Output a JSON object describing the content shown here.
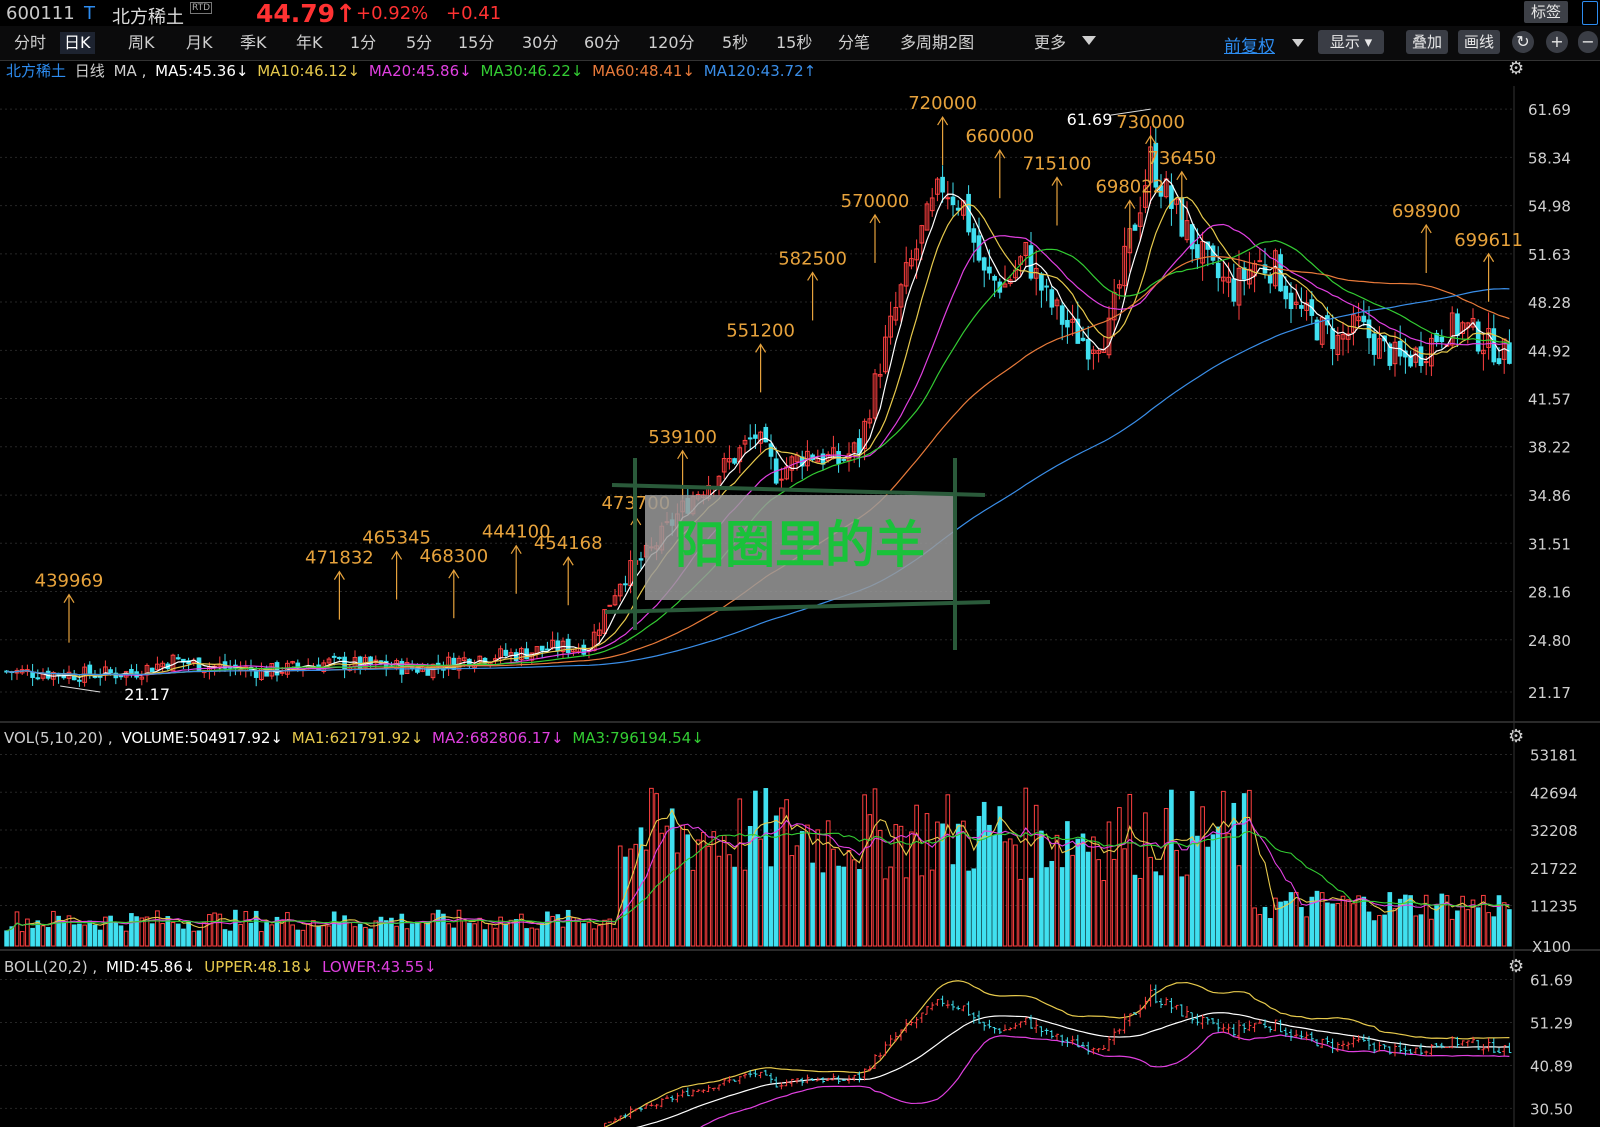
{
  "header": {
    "code": "600111",
    "flag": "T",
    "name": "北方稀土",
    "rtd": "RTD",
    "price": "44.79↑",
    "pct": "+0.92%",
    "change": "+0.41",
    "tag_button": "标签"
  },
  "periods": [
    "分时",
    "日K",
    "周K",
    "月K",
    "季K",
    "年K",
    "1分",
    "5分",
    "15分",
    "30分",
    "60分",
    "120分",
    "5秒",
    "15秒",
    "分笔",
    "多周期2图",
    "更多"
  ],
  "selected_period": "日K",
  "toolbar": {
    "adjust": "前复权",
    "display": "显示",
    "overlay": "叠加",
    "draw": "画线",
    "refresh_icon": "↻",
    "zoom_in": "+",
    "zoom_out": "−"
  },
  "main_legend": {
    "name": "北方稀土",
    "period": "日线",
    "ma": "MA ,",
    "ma5": "MA5:45.36↓",
    "ma10": "MA10:46.12↓",
    "ma20": "MA20:45.86↓",
    "ma30": "MA30:46.22↓",
    "ma60": "MA60:48.41↓",
    "ma120": "MA120:43.72↑"
  },
  "vol_legend": {
    "name": "VOL(5,10,20) ,",
    "volume": "VOLUME:504917.92↓",
    "ma1": "MA1:621791.92↓",
    "ma2": "MA2:682806.17↓",
    "ma3": "MA3:796194.54↓"
  },
  "boll_legend": {
    "name": "BOLL(20,2) ,",
    "mid": "MID:45.86↓",
    "upper": "UPPER:48.18↓",
    "lower": "LOWER:43.55↓"
  },
  "watermark": "阳圈里的羊",
  "colors": {
    "up": "#ff4040",
    "down": "#40e0f0",
    "ma5": "#ffffff",
    "ma10": "#e6c94c",
    "ma20": "#e040e0",
    "ma30": "#33cc33",
    "ma60": "#e87a3a",
    "ma120": "#3a8ee8"
  },
  "chart_data": [
    {
      "type": "candlestick",
      "panel": "price",
      "y_ticks": [
        "61.69",
        "58.34",
        "54.98",
        "51.63",
        "48.28",
        "44.92",
        "41.57",
        "38.22",
        "34.86",
        "31.51",
        "28.16",
        "24.80",
        "21.17"
      ],
      "ylim": [
        19.5,
        63.3
      ],
      "high": 61.69,
      "low": 21.17,
      "trend": [
        [
          0,
          22.6
        ],
        [
          14,
          22.4
        ],
        [
          24,
          22.5
        ],
        [
          32,
          23.4
        ],
        [
          38,
          23.0
        ],
        [
          50,
          22.6
        ],
        [
          62,
          23.2
        ],
        [
          72,
          23.0
        ],
        [
          80,
          22.8
        ],
        [
          90,
          23.6
        ],
        [
          98,
          23.8
        ],
        [
          104,
          24.2
        ],
        [
          112,
          24.4
        ],
        [
          118,
          29.0
        ],
        [
          124,
          31.0
        ],
        [
          128,
          33.0
        ],
        [
          132,
          34.8
        ],
        [
          138,
          36.8
        ],
        [
          144,
          39.0
        ],
        [
          148,
          36.4
        ],
        [
          154,
          37.8
        ],
        [
          160,
          37.2
        ],
        [
          164,
          38.2
        ],
        [
          168,
          44.0
        ],
        [
          172,
          49.0
        ],
        [
          176,
          53.0
        ],
        [
          180,
          56.5
        ],
        [
          184,
          55.0
        ],
        [
          188,
          50.0
        ],
        [
          192,
          49.5
        ],
        [
          196,
          51.6
        ],
        [
          200,
          48.5
        ],
        [
          204,
          46.6
        ],
        [
          208,
          45.4
        ],
        [
          212,
          46.3
        ],
        [
          216,
          52.5
        ],
        [
          220,
          58.2
        ],
        [
          224,
          55.0
        ],
        [
          228,
          52.5
        ],
        [
          232,
          50.2
        ],
        [
          236,
          49.2
        ],
        [
          240,
          51.0
        ],
        [
          244,
          50.7
        ],
        [
          248,
          47.8
        ],
        [
          252,
          46.6
        ],
        [
          256,
          45.6
        ],
        [
          260,
          46.6
        ],
        [
          264,
          45.2
        ],
        [
          268,
          44.2
        ],
        [
          272,
          44.8
        ],
        [
          276,
          46.3
        ],
        [
          280,
          46.6
        ],
        [
          284,
          45.6
        ],
        [
          288,
          44.7
        ]
      ],
      "vol_annotations": [
        {
          "label": "439969",
          "bar": 12,
          "price": 24.6
        },
        {
          "label": "471832",
          "bar": 64,
          "price": 26.2
        },
        {
          "label": "465345",
          "bar": 75,
          "price": 27.6
        },
        {
          "label": "468300",
          "bar": 86,
          "price": 26.3
        },
        {
          "label": "444100",
          "bar": 98,
          "price": 28.0
        },
        {
          "label": "454168",
          "bar": 108,
          "price": 27.2
        },
        {
          "label": "473700",
          "bar": 121,
          "price": 30.0
        },
        {
          "label": "539100",
          "bar": 130,
          "price": 34.6
        },
        {
          "label": "551200",
          "bar": 145,
          "price": 42.0
        },
        {
          "label": "582500",
          "bar": 155,
          "price": 47.0
        },
        {
          "label": "570000",
          "bar": 167,
          "price": 51.0
        },
        {
          "label": "720000",
          "bar": 180,
          "price": 57.8
        },
        {
          "label": "660000",
          "bar": 191,
          "price": 55.5
        },
        {
          "label": "715100",
          "bar": 202,
          "price": 53.6
        },
        {
          "label": "698022",
          "bar": 216,
          "price": 52.0
        },
        {
          "label": "730000",
          "bar": 220,
          "price": 56.5
        },
        {
          "label": "736450",
          "bar": 226,
          "price": 54.0
        },
        {
          "label": "698900",
          "bar": 273,
          "price": 50.3
        },
        {
          "label": "699611",
          "bar": 285,
          "price": 48.3
        }
      ],
      "price_labels": [
        {
          "label": "61.69",
          "bar": 220,
          "price": 61.69
        },
        {
          "label": "21.17",
          "bar": 18,
          "price": 21.17
        }
      ]
    },
    {
      "type": "bar",
      "panel": "volume",
      "y_ticks": [
        "53181",
        "42694",
        "32208",
        "21722",
        "11235"
      ],
      "unit": "X100",
      "ylim": [
        0,
        55000
      ]
    },
    {
      "type": "line",
      "panel": "boll",
      "y_ticks": [
        "61.69",
        "51.29",
        "40.89",
        "30.50"
      ],
      "ylim": [
        26.0,
        64.0
      ]
    }
  ]
}
